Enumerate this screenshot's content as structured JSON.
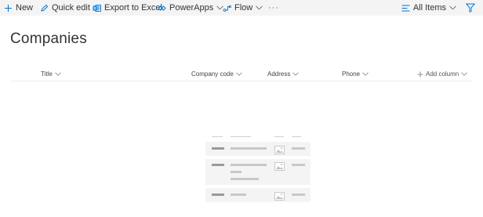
{
  "toolbar": {
    "new_label": "New",
    "quick_edit_label": "Quick edit",
    "export_label": "Export to Excel",
    "powerapps_label": "PowerApps",
    "flow_label": "Flow",
    "more_label": "···",
    "view_label": "All Items"
  },
  "page": {
    "title": "Companies"
  },
  "columns": {
    "title": "Title",
    "company_code": "Company code",
    "address": "Address",
    "phone": "Phone",
    "add_column": "Add column"
  },
  "colors": {
    "accent": "#0078d4",
    "command_bar_bg": "#f4f4f4",
    "placeholder_row": "#f4f4f4"
  },
  "icons": {
    "new": "plus-icon",
    "quick_edit": "pencil-icon",
    "export": "excel-icon",
    "powerapps": "powerapps-icon",
    "flow": "flow-icon",
    "view": "view-lines-icon",
    "filter": "funnel-icon"
  }
}
